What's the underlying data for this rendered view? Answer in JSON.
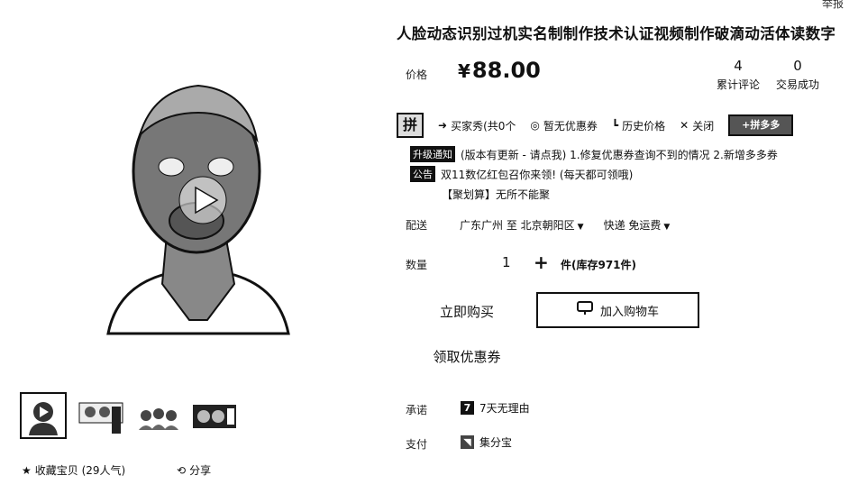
{
  "header": {
    "report_label": "举报"
  },
  "product": {
    "title": "人脸动态识别过机实名制制作技术认证视频制作破滴动活体读数字",
    "price_label": "价格",
    "currency": "¥",
    "price": "88.00",
    "stats": [
      {
        "value": "4",
        "label": "累计评论"
      },
      {
        "value": "0",
        "label": "交易成功"
      }
    ]
  },
  "toolbar": {
    "badge": "拼",
    "buyer_show": "买家秀(共0个",
    "no_coupon": "暂无优惠券",
    "price_history": "历史价格",
    "close": "关闭",
    "pdd_label": "+拼多多"
  },
  "notices": [
    {
      "tag": "升级通知",
      "text": "(版本有更新 - 请点我) 1.修复优惠券查询不到的情况 2.新增多多券"
    },
    {
      "tag": "公告",
      "text": "双11数亿红包召你来领!  (每天都可领哦)"
    },
    {
      "tag": "",
      "text": "【聚划算】无所不能聚"
    }
  ],
  "shipping": {
    "label": "配送",
    "from": "广东广州 至",
    "to": "北京朝阳区",
    "method": "快递 免运费"
  },
  "quantity": {
    "label": "数量",
    "value": "1",
    "plus": "+",
    "stock": "件(库存971件)"
  },
  "actions": {
    "buy_now": "立即购买",
    "add_to_cart": "加入购物车",
    "get_coupon": "领取优惠券"
  },
  "service": {
    "promise_label": "承诺",
    "promise_icon": "7",
    "promise_text": "7天无理由",
    "pay_label": "支付",
    "pay_text": "集分宝"
  },
  "footer": {
    "favorite": "收藏宝贝 (29人气)",
    "share": "分享"
  }
}
